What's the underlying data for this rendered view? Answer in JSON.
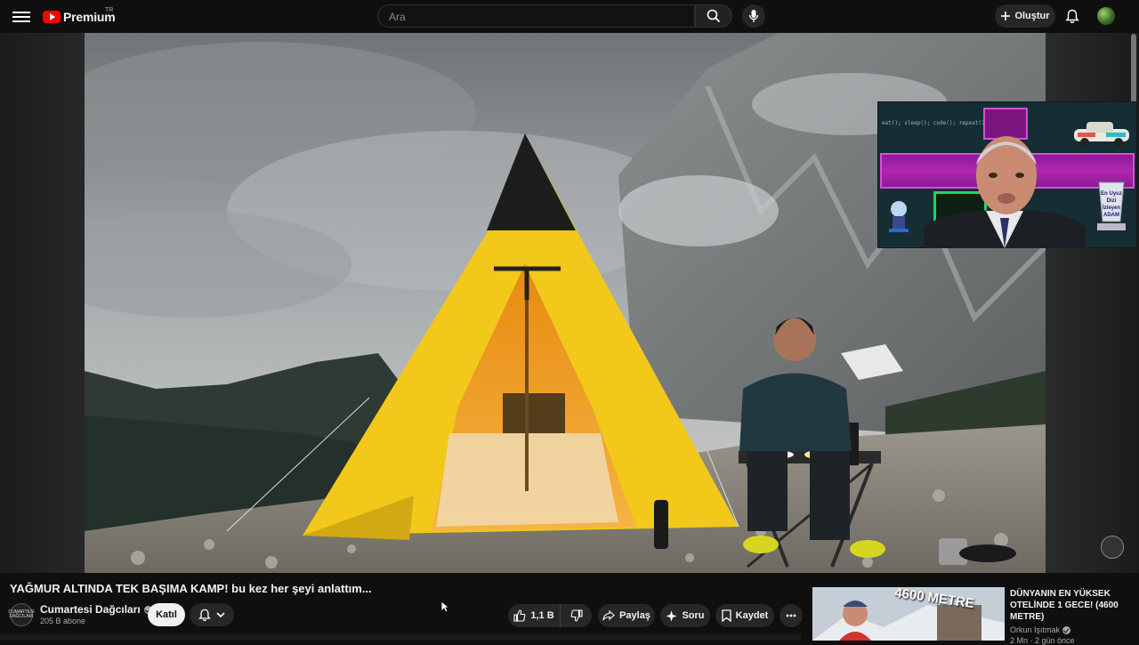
{
  "header": {
    "logo_text": "Premium",
    "logo_region": "TR",
    "search_placeholder": "Ara",
    "create_label": "Oluştur"
  },
  "overlay": {
    "label_lines": [
      "En Uyuz",
      "Dizi",
      "İzleyen",
      "ADAM"
    ],
    "code_text": "eat();   sleep();   code();   repeat();"
  },
  "video": {
    "title": "YAĞMUR ALTINDA TEK BAŞIMA KAMP! bu kez her şeyi anlattım..."
  },
  "channel": {
    "avatar_text": "CUMARTESİ DAĞCILARI",
    "name": "Cumartesi Dağcıları",
    "subscribers": "205 B abone",
    "join_label": "Katıl"
  },
  "actions": {
    "like_count": "1,1 B",
    "share_label": "Paylaş",
    "ask_label": "Soru",
    "save_label": "Kaydet"
  },
  "recommended": {
    "title": "DÜNYANIN EN YÜKSEK OTELİNDE 1 GECE! (4600 METRE)",
    "thumb_text": "4600 METRE",
    "channel": "Orkun Işıtmak",
    "meta": "2 Mn · 2 gün önce"
  },
  "colors": {
    "background": "#0f0f0f",
    "brand_red": "#ff0000",
    "tent_yellow": "#f2c81a",
    "overlay_purple": "#b028b0",
    "overlay_green": "#1ed760"
  }
}
